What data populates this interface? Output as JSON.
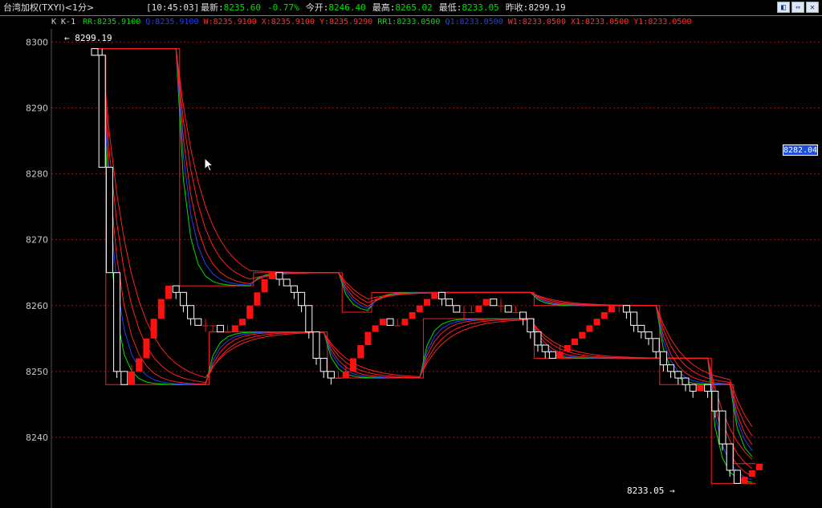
{
  "window": {
    "title": "台湾加权(TXYI)<1分>",
    "time": "[10:45:03]",
    "buttons": [
      "◧",
      "⇔",
      "✕"
    ]
  },
  "quote": [
    {
      "label": "最新:",
      "value": "8235.60",
      "color": "#00e000"
    },
    {
      "label": "",
      "value": "-0.77%",
      "color": "#00e000"
    },
    {
      "label": "今开:",
      "value": "8246.40",
      "color": "#00e000"
    },
    {
      "label": "最高:",
      "value": "8265.02",
      "color": "#00e000"
    },
    {
      "label": "最低:",
      "value": "8233.05",
      "color": "#00e000"
    },
    {
      "label": "昨收:",
      "value": "8299.19",
      "color": "#e0e0e0"
    }
  ],
  "indicator_header": {
    "prefix": "K  K-1",
    "items": [
      {
        "text": "RR:8235.9100",
        "color": "#00e000"
      },
      {
        "text": "Q:8235.9100",
        "color": "#2040ff"
      },
      {
        "text": "W:8235.9100",
        "color": "#ff3030"
      },
      {
        "text": "X:8235.9100",
        "color": "#ff3030"
      },
      {
        "text": "Y:8235.9290",
        "color": "#ff3030"
      },
      {
        "text": "RR1:8233.0500",
        "color": "#00e000"
      },
      {
        "text": "Q1:8233.0500",
        "color": "#2040ff"
      },
      {
        "text": "W1:8233.0500",
        "color": "#ff3030"
      },
      {
        "text": "X1:8233.0500",
        "color": "#ff3030"
      },
      {
        "text": "Y1:8233.0500",
        "color": "#ff3030"
      }
    ]
  },
  "y_axis": {
    "ticks": [
      "8300",
      "8290",
      "8280",
      "8270",
      "8260",
      "8250",
      "8240"
    ]
  },
  "markers": {
    "current_price": "8282.04",
    "high": "8299.19",
    "low": "8233.05"
  },
  "colors": {
    "up": "#ff1010",
    "down": "#ffffff",
    "grid": "#8b1a1a",
    "green": "#00e000",
    "blue": "#2040ff",
    "red": "#ff2020"
  },
  "chart_data": {
    "type": "candlestick",
    "ylim": [
      8230,
      8302
    ],
    "ticks": [
      8300,
      8290,
      8280,
      8270,
      8260,
      8250,
      8240
    ],
    "bands": [
      {
        "name": "upper",
        "values": [
          8299,
          8299,
          8299,
          8299,
          8299,
          8299,
          8299,
          8299,
          8299,
          8299,
          8299,
          8299,
          8263,
          8263,
          8263,
          8263,
          8263,
          8263,
          8263,
          8263,
          8263,
          8263,
          8265,
          8265,
          8265,
          8265,
          8265,
          8265,
          8265,
          8265,
          8265,
          8265,
          8265,
          8265,
          8259,
          8259,
          8259,
          8259,
          8262,
          8262,
          8262,
          8262,
          8262,
          8262,
          8262,
          8262,
          8262,
          8262,
          8262,
          8262,
          8262,
          8262,
          8262,
          8262,
          8262,
          8262,
          8262,
          8262,
          8262,
          8262,
          8260,
          8260,
          8260,
          8260,
          8260,
          8260,
          8260,
          8260,
          8260,
          8260,
          8260,
          8260,
          8260,
          8260,
          8260,
          8260,
          8260,
          8248,
          8248,
          8248,
          8248,
          8248,
          8248,
          8248,
          8248,
          8248,
          8248,
          8236,
          8236,
          8236
        ]
      },
      {
        "name": "lower",
        "values": [
          8298,
          8298,
          8248,
          8248,
          8248,
          8248,
          8248,
          8248,
          8248,
          8248,
          8248,
          8248,
          8248,
          8248,
          8248,
          8248,
          8256,
          8256,
          8256,
          8256,
          8256,
          8256,
          8256,
          8256,
          8256,
          8256,
          8256,
          8256,
          8256,
          8256,
          8256,
          8256,
          8249,
          8249,
          8249,
          8249,
          8249,
          8249,
          8249,
          8249,
          8249,
          8249,
          8249,
          8249,
          8249,
          8258,
          8258,
          8258,
          8258,
          8258,
          8258,
          8258,
          8258,
          8258,
          8258,
          8258,
          8258,
          8258,
          8258,
          8258,
          8252,
          8252,
          8252,
          8252,
          8252,
          8252,
          8252,
          8252,
          8252,
          8252,
          8252,
          8252,
          8252,
          8252,
          8252,
          8252,
          8252,
          8252,
          8252,
          8252,
          8252,
          8252,
          8252,
          8252,
          8233,
          8233,
          8233,
          8233,
          8233,
          8233
        ]
      }
    ],
    "candles": [
      [
        8299,
        8298,
        8299,
        8298
      ],
      [
        8298,
        8281,
        8299,
        8281
      ],
      [
        8281,
        8265,
        8281,
        8265
      ],
      [
        8265,
        8250,
        8265,
        8249
      ],
      [
        8250,
        8248,
        8250,
        8248
      ],
      [
        8248,
        8250,
        8251,
        8248
      ],
      [
        8250,
        8252,
        8252,
        8250
      ],
      [
        8252,
        8255,
        8255,
        8252
      ],
      [
        8255,
        8258,
        8258,
        8255
      ],
      [
        8258,
        8261,
        8261,
        8258
      ],
      [
        8261,
        8263,
        8263,
        8261
      ],
      [
        8263,
        8262,
        8263,
        8261
      ],
      [
        8262,
        8260,
        8262,
        8259
      ],
      [
        8260,
        8258,
        8260,
        8257
      ],
      [
        8258,
        8257,
        8258,
        8257
      ],
      [
        8257,
        8257,
        8258,
        8256
      ],
      [
        8257,
        8257,
        8257,
        8256
      ],
      [
        8257,
        8256,
        8257,
        8256
      ],
      [
        8256,
        8256,
        8257,
        8256
      ],
      [
        8256,
        8257,
        8257,
        8256
      ],
      [
        8257,
        8258,
        8258,
        8257
      ],
      [
        8258,
        8260,
        8260,
        8258
      ],
      [
        8260,
        8262,
        8262,
        8260
      ],
      [
        8262,
        8264,
        8264,
        8262
      ],
      [
        8264,
        8265,
        8265,
        8264
      ],
      [
        8265,
        8264,
        8265,
        8263
      ],
      [
        8264,
        8263,
        8264,
        8263
      ],
      [
        8263,
        8262,
        8263,
        8261
      ],
      [
        8262,
        8260,
        8262,
        8259
      ],
      [
        8260,
        8256,
        8260,
        8255
      ],
      [
        8256,
        8252,
        8256,
        8251
      ],
      [
        8252,
        8250,
        8252,
        8249
      ],
      [
        8250,
        8249,
        8250,
        8248
      ],
      [
        8249,
        8249,
        8250,
        8249
      ],
      [
        8249,
        8250,
        8251,
        8249
      ],
      [
        8250,
        8252,
        8252,
        8250
      ],
      [
        8252,
        8254,
        8254,
        8252
      ],
      [
        8254,
        8256,
        8256,
        8254
      ],
      [
        8256,
        8257,
        8257,
        8256
      ],
      [
        8257,
        8258,
        8258,
        8257
      ],
      [
        8258,
        8257,
        8258,
        8257
      ],
      [
        8257,
        8257,
        8258,
        8257
      ],
      [
        8257,
        8258,
        8258,
        8257
      ],
      [
        8258,
        8259,
        8259,
        8258
      ],
      [
        8259,
        8260,
        8260,
        8259
      ],
      [
        8260,
        8261,
        8261,
        8260
      ],
      [
        8261,
        8262,
        8262,
        8261
      ],
      [
        8262,
        8261,
        8262,
        8260
      ],
      [
        8261,
        8260,
        8261,
        8260
      ],
      [
        8260,
        8259,
        8260,
        8259
      ],
      [
        8259,
        8259,
        8260,
        8258
      ],
      [
        8259,
        8259,
        8260,
        8259
      ],
      [
        8259,
        8260,
        8260,
        8259
      ],
      [
        8260,
        8261,
        8261,
        8260
      ],
      [
        8261,
        8260,
        8261,
        8260
      ],
      [
        8260,
        8260,
        8261,
        8259
      ],
      [
        8260,
        8259,
        8260,
        8259
      ],
      [
        8259,
        8259,
        8260,
        8259
      ],
      [
        8259,
        8258,
        8259,
        8257
      ],
      [
        8258,
        8256,
        8258,
        8255
      ],
      [
        8256,
        8254,
        8256,
        8253
      ],
      [
        8254,
        8253,
        8254,
        8252
      ],
      [
        8253,
        8252,
        8253,
        8252
      ],
      [
        8252,
        8253,
        8254,
        8252
      ],
      [
        8253,
        8254,
        8254,
        8253
      ],
      [
        8254,
        8255,
        8255,
        8254
      ],
      [
        8255,
        8256,
        8256,
        8255
      ],
      [
        8256,
        8257,
        8257,
        8256
      ],
      [
        8257,
        8258,
        8258,
        8257
      ],
      [
        8258,
        8259,
        8259,
        8258
      ],
      [
        8259,
        8260,
        8260,
        8259
      ],
      [
        8260,
        8260,
        8260,
        8259
      ],
      [
        8260,
        8259,
        8260,
        8258
      ],
      [
        8259,
        8257,
        8259,
        8256
      ],
      [
        8257,
        8256,
        8257,
        8255
      ],
      [
        8256,
        8255,
        8256,
        8254
      ],
      [
        8255,
        8253,
        8255,
        8252
      ],
      [
        8253,
        8251,
        8253,
        8250
      ],
      [
        8251,
        8250,
        8251,
        8249
      ],
      [
        8250,
        8249,
        8250,
        8248
      ],
      [
        8249,
        8248,
        8249,
        8247
      ],
      [
        8248,
        8247,
        8248,
        8246
      ],
      [
        8247,
        8248,
        8248,
        8247
      ],
      [
        8248,
        8247,
        8248,
        8246
      ],
      [
        8247,
        8244,
        8247,
        8243
      ],
      [
        8244,
        8239,
        8244,
        8238
      ],
      [
        8239,
        8235,
        8239,
        8234
      ],
      [
        8235,
        8233,
        8235,
        8233
      ],
      [
        8233,
        8234,
        8234,
        8233
      ],
      [
        8234,
        8235,
        8235,
        8234
      ],
      [
        8235,
        8236,
        8236,
        8235
      ]
    ]
  }
}
